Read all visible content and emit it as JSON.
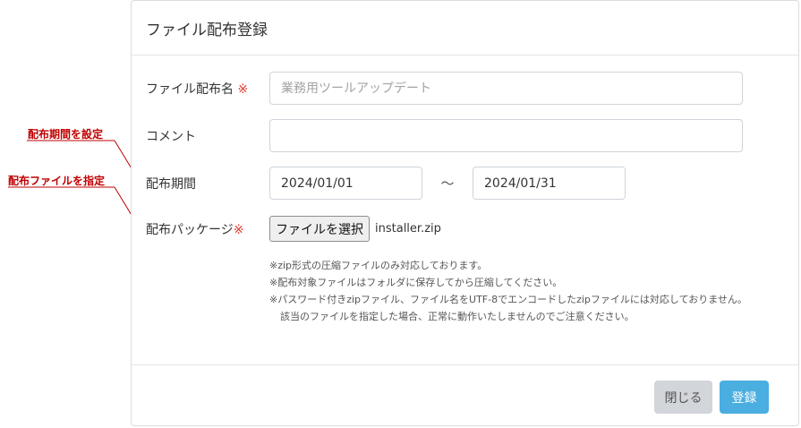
{
  "modal": {
    "title": "ファイル配布登録",
    "fields": {
      "name": {
        "label": "ファイル配布名",
        "required_mark": "※",
        "placeholder": "業務用ツールアップデート",
        "value": ""
      },
      "comment": {
        "label": "コメント",
        "value": ""
      },
      "period": {
        "label": "配布期間",
        "start": "2024/01/01",
        "separator": "～",
        "end": "2024/01/31"
      },
      "package": {
        "label": "配布パッケージ",
        "required_mark": "※",
        "button_label": "ファイルを選択",
        "file_name": "installer.zip"
      }
    },
    "notes": [
      "※zip形式の圧縮ファイルのみ対応しております。",
      "※配布対象ファイルはフォルダに保存してから圧縮してください。",
      "※パスワード付きzipファイル、ファイル名をUTF-8でエンコードしたzipファイルには対応しておりません。",
      "該当のファイルを指定した場合、正常に動作いたしませんのでご注意ください。"
    ],
    "buttons": {
      "close": "閉じる",
      "register": "登録"
    }
  },
  "annotations": {
    "period_label": "配布期間を設定",
    "package_label": "配布ファイルを指定",
    "color": "#c00000"
  },
  "colors": {
    "required": "#e03c31",
    "primary_button": "#4aaee0",
    "secondary_button": "#d2d5da"
  }
}
